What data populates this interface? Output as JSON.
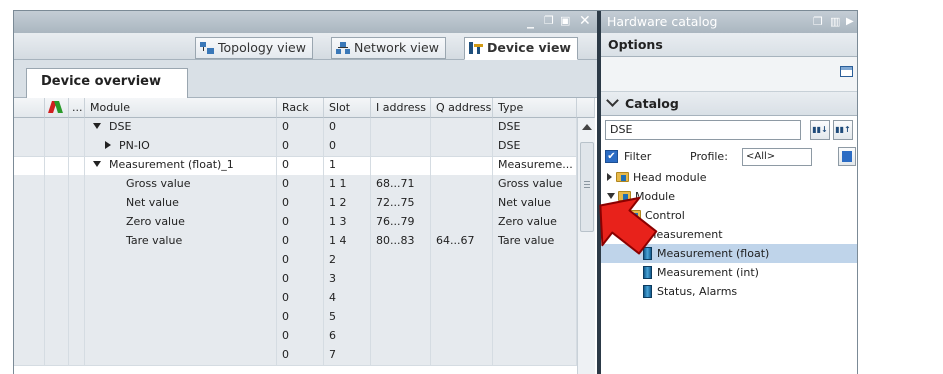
{
  "window": {
    "controls": [
      "minimize",
      "restore",
      "maximize",
      "close"
    ]
  },
  "views": {
    "topology": "Topology view",
    "network": "Network view",
    "device": "Device view"
  },
  "device_overview": {
    "tab": "Device overview",
    "columns": [
      "...",
      "Module",
      "Rack",
      "Slot",
      "I address",
      "Q address",
      "Type"
    ],
    "rows": [
      {
        "module": "DSE",
        "expand": "down",
        "rack": "0",
        "slot": "0",
        "i_address": "",
        "q_address": "",
        "type": "DSE",
        "gray": true
      },
      {
        "module": "PN-IO",
        "expand": "right",
        "rack": "0",
        "slot": "0",
        "i_address": "",
        "q_address": "",
        "type": "DSE",
        "gray": true
      },
      {
        "module": "Measurement (float)_1",
        "expand": "down",
        "rack": "0",
        "slot": "1",
        "i_address": "",
        "q_address": "",
        "type": "Measureme...",
        "gray": false
      },
      {
        "module": "Gross value",
        "expand": "",
        "rack": "0",
        "slot": "1 1",
        "i_address": "68...71",
        "q_address": "",
        "type": "Gross value",
        "gray": true
      },
      {
        "module": "Net value",
        "expand": "",
        "rack": "0",
        "slot": "1 2",
        "i_address": "72...75",
        "q_address": "",
        "type": "Net value",
        "gray": true
      },
      {
        "module": "Zero value",
        "expand": "",
        "rack": "0",
        "slot": "1 3",
        "i_address": "76...79",
        "q_address": "",
        "type": "Zero value",
        "gray": true
      },
      {
        "module": "Tare value",
        "expand": "",
        "rack": "0",
        "slot": "1 4",
        "i_address": "80...83",
        "q_address": "64...67",
        "type": "Tare value",
        "gray": true
      },
      {
        "module": "",
        "expand": "",
        "rack": "0",
        "slot": "2",
        "i_address": "",
        "q_address": "",
        "type": "",
        "gray": true
      },
      {
        "module": "",
        "expand": "",
        "rack": "0",
        "slot": "3",
        "i_address": "",
        "q_address": "",
        "type": "",
        "gray": true
      },
      {
        "module": "",
        "expand": "",
        "rack": "0",
        "slot": "4",
        "i_address": "",
        "q_address": "",
        "type": "",
        "gray": true
      },
      {
        "module": "",
        "expand": "",
        "rack": "0",
        "slot": "5",
        "i_address": "",
        "q_address": "",
        "type": "",
        "gray": true
      },
      {
        "module": "",
        "expand": "",
        "rack": "0",
        "slot": "6",
        "i_address": "",
        "q_address": "",
        "type": "",
        "gray": true
      },
      {
        "module": "",
        "expand": "",
        "rack": "0",
        "slot": "7",
        "i_address": "",
        "q_address": "",
        "type": "",
        "gray": true
      }
    ]
  },
  "catalog_panel": {
    "title": "Hardware catalog",
    "options_label": "Options",
    "catalog_label": "Catalog",
    "search_value": "DSE",
    "filter_label": "Filter",
    "profile_label": "Profile:",
    "profile_value": "<All>",
    "tree": [
      {
        "label": "Head module",
        "kind": "folder",
        "expand": "right",
        "level": 0
      },
      {
        "label": "Module",
        "kind": "folder",
        "expand": "down",
        "level": 0
      },
      {
        "label": "Control",
        "kind": "folder",
        "expand": "right",
        "level": 1
      },
      {
        "label": "Measurement",
        "kind": "folder",
        "expand": "down",
        "level": 1
      },
      {
        "label": "Measurement (float)",
        "kind": "module",
        "expand": "",
        "level": 2,
        "selected": true
      },
      {
        "label": "Measurement (int)",
        "kind": "module",
        "expand": "",
        "level": 2
      },
      {
        "label": "Status, Alarms",
        "kind": "module",
        "expand": "",
        "level": 2
      }
    ]
  },
  "colors": {
    "accent": "#2b6cc4",
    "arrow": "#e8221b",
    "title_bar": "#aab6c0",
    "splitter": "#2c3a47"
  }
}
